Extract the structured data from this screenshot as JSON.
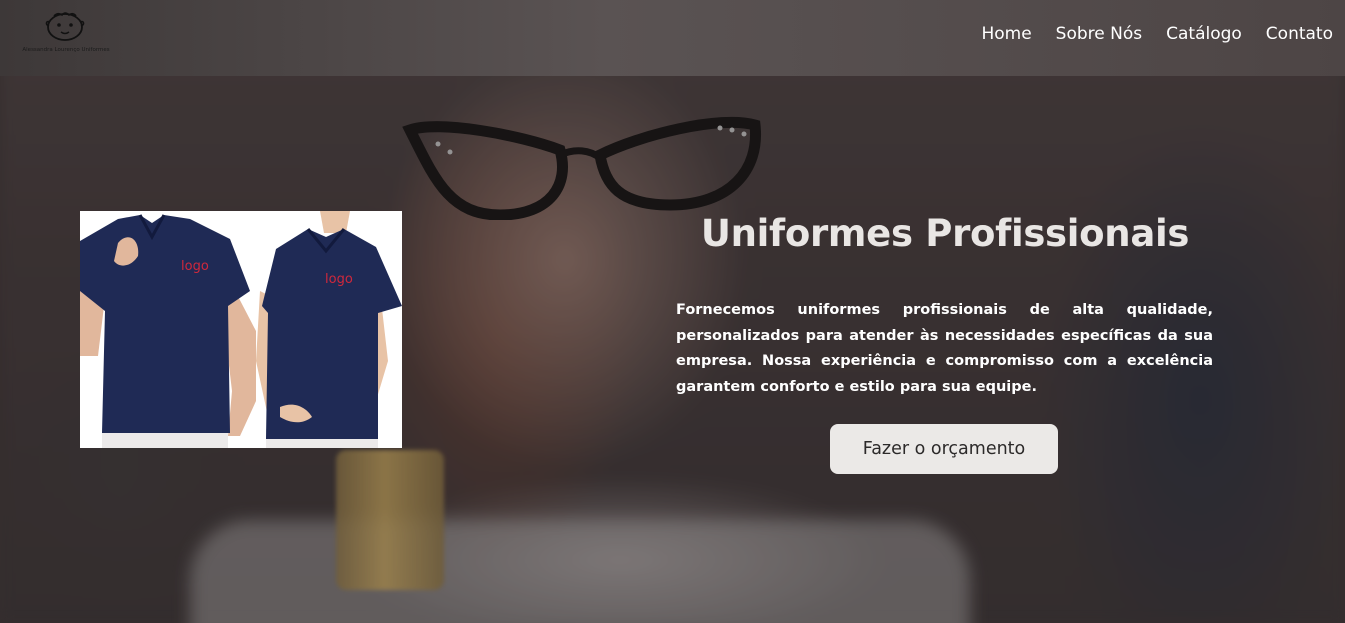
{
  "header": {
    "logo_text": "Alessandra Lourenço Uniformes",
    "logo_icon": "sheep-icon",
    "nav": [
      {
        "label": "Home"
      },
      {
        "label": "Sobre Nós"
      },
      {
        "label": "Catálogo"
      },
      {
        "label": "Contato"
      }
    ]
  },
  "hero": {
    "title": "Uniformes Profissionais",
    "description": "Fornecemos uniformes profissionais de alta qualidade, personalizados para atender às necessidades específicas da sua empresa. Nossa experiência e compromisso com a excelência garantem conforto e estilo para sua equipe.",
    "cta_label": "Fazer o orçamento",
    "image": {
      "logo_label_1": "logo",
      "logo_label_2": "logo",
      "shirt_color": "#1f2a55",
      "logo_color": "#d0283c"
    }
  },
  "colors": {
    "header_bg": "#4f4848",
    "nav_text": "#ffffff",
    "title_text": "#e9e6e4",
    "button_bg": "#ebe9e7",
    "button_text": "#2c2a2a"
  }
}
